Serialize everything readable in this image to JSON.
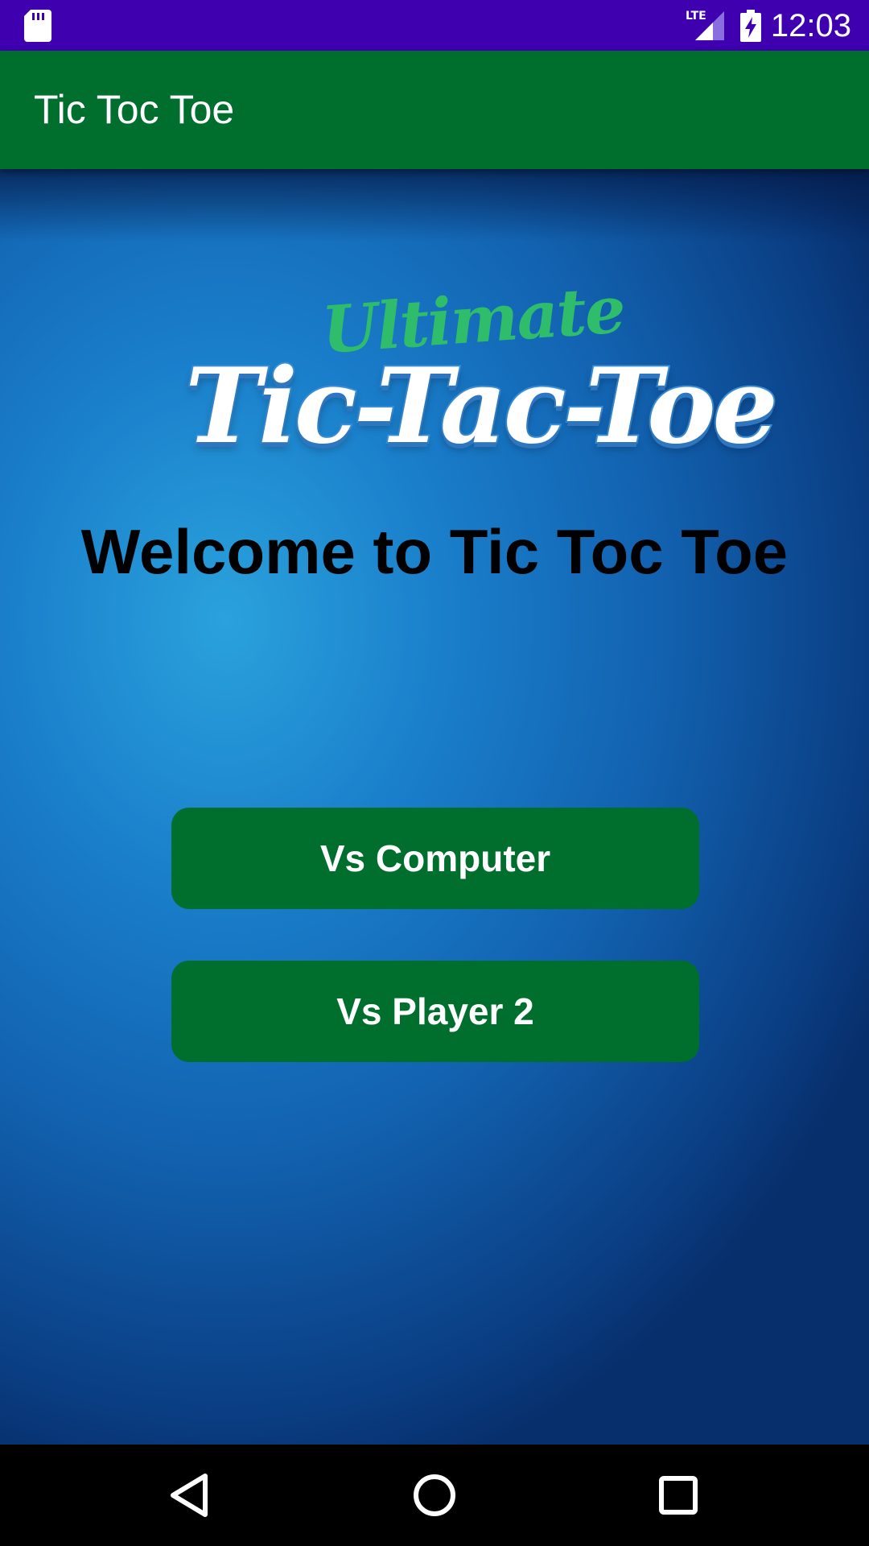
{
  "status_bar": {
    "time": "12:03",
    "network": "LTE",
    "icons": [
      "sd-card-icon",
      "lte-signal-icon",
      "battery-charging-icon"
    ]
  },
  "app_bar": {
    "title": "Tic Toc Toe",
    "color": "#006e2d"
  },
  "logo": {
    "ultimate_text": "Ultimate",
    "main_text": "Tic-Tac-Toe"
  },
  "main": {
    "welcome_text": "Welcome to Tic Toc Toe",
    "buttons": [
      {
        "label": "Vs Computer"
      },
      {
        "label": "Vs Player 2"
      }
    ]
  },
  "nav_bar": {
    "icons": [
      "back-icon",
      "home-icon",
      "recents-icon"
    ]
  },
  "colors": {
    "status_bar": "#3f00b0",
    "accent": "#006e2d",
    "background_blue": "#1a7fcb"
  }
}
